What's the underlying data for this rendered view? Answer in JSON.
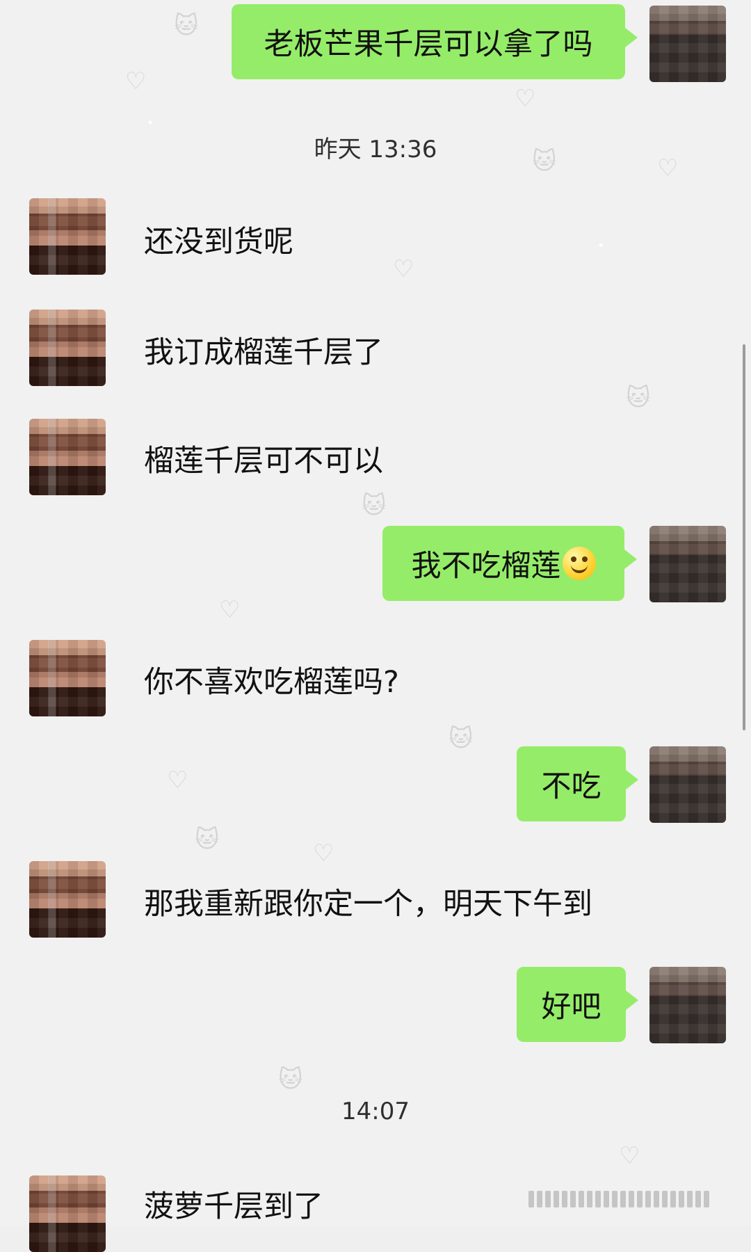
{
  "messages": {
    "m1": "老板芒果千层可以拿了吗",
    "t1": "昨天 13:36",
    "m2": "还没到货呢",
    "m3": "我订成榴莲千层了",
    "m4": "榴莲千层可不可以",
    "m5": "我不吃榴莲",
    "m6": "你不喜欢吃榴莲吗?",
    "m7": "不吃",
    "m8": "那我重新跟你定一个，明天下午到",
    "m9": "好吧",
    "t2": "14:07",
    "m10": "菠萝千层到了"
  },
  "colors": {
    "bubble_green": "#95ec69",
    "background": "#efefef"
  },
  "icons": {
    "emoji": "smile-emoji"
  }
}
